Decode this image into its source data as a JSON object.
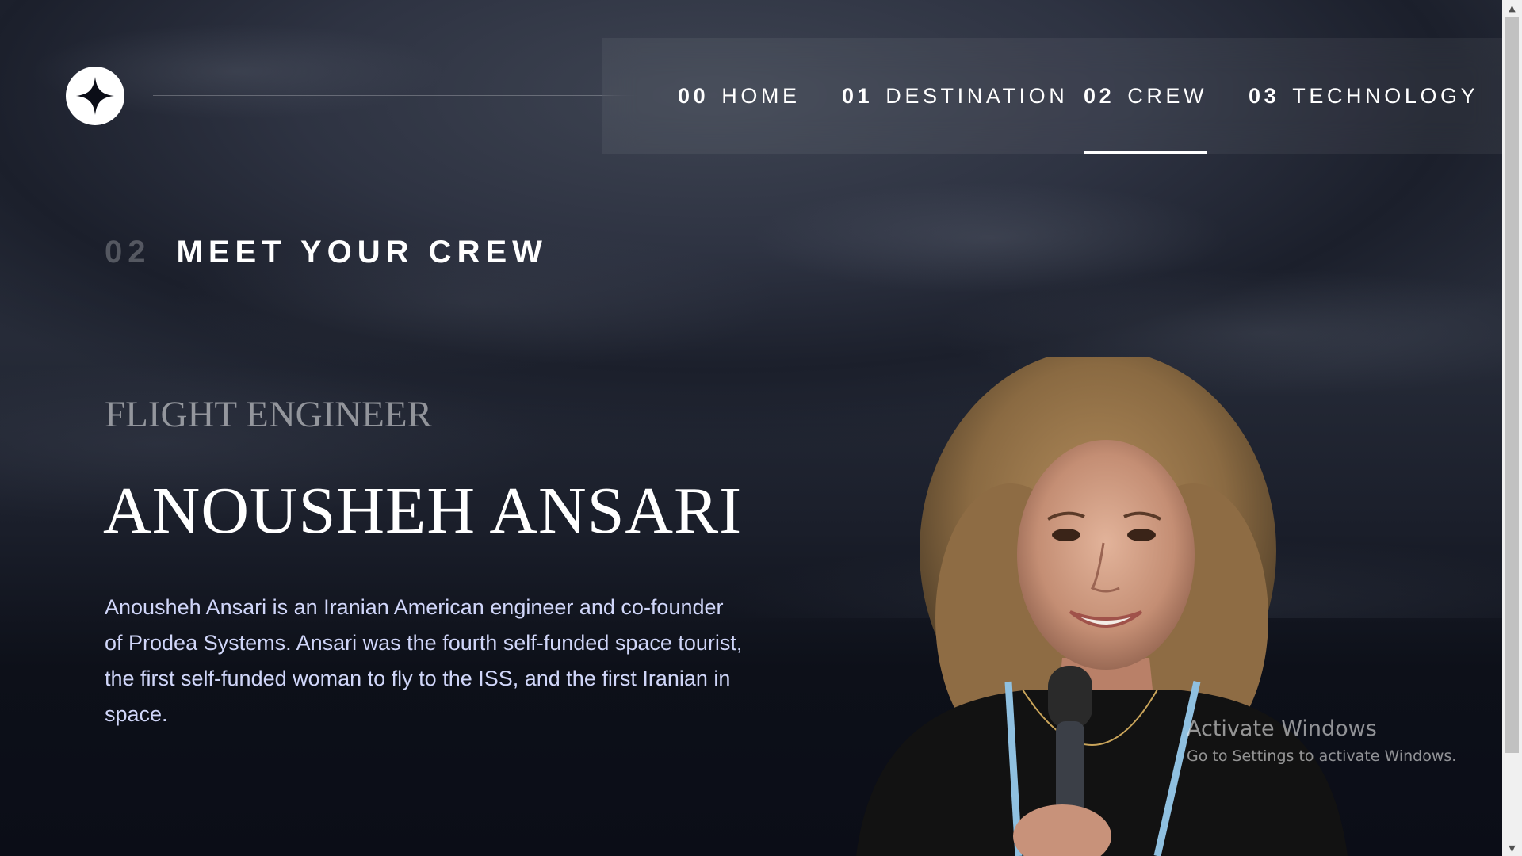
{
  "nav": {
    "items": [
      {
        "num": "00",
        "label": "HOME"
      },
      {
        "num": "01",
        "label": "DESTINATION"
      },
      {
        "num": "02",
        "label": "CREW"
      },
      {
        "num": "03",
        "label": "TECHNOLOGY"
      }
    ],
    "active_index": 2
  },
  "page_heading": {
    "num": "02",
    "title": "MEET YOUR CREW"
  },
  "crew": {
    "role": "FLIGHT ENGINEER",
    "name": "ANOUSHEH ANSARI",
    "bio": "Anousheh Ansari is an Iranian American engineer and co-founder of Prodea Systems. Ansari was the fourth self-funded space tourist, the first self-funded woman to fly to the ISS, and the first Iranian in space."
  },
  "watermark": {
    "title": "Activate Windows",
    "subtitle": "Go to Settings to activate Windows."
  },
  "icons": {
    "logo": "star-logo-icon",
    "scroll_up": "chevron-up-icon",
    "scroll_down": "chevron-down-icon"
  },
  "colors": {
    "background": "#0b0d17",
    "text_light": "#d0d6f9",
    "white": "#ffffff"
  }
}
